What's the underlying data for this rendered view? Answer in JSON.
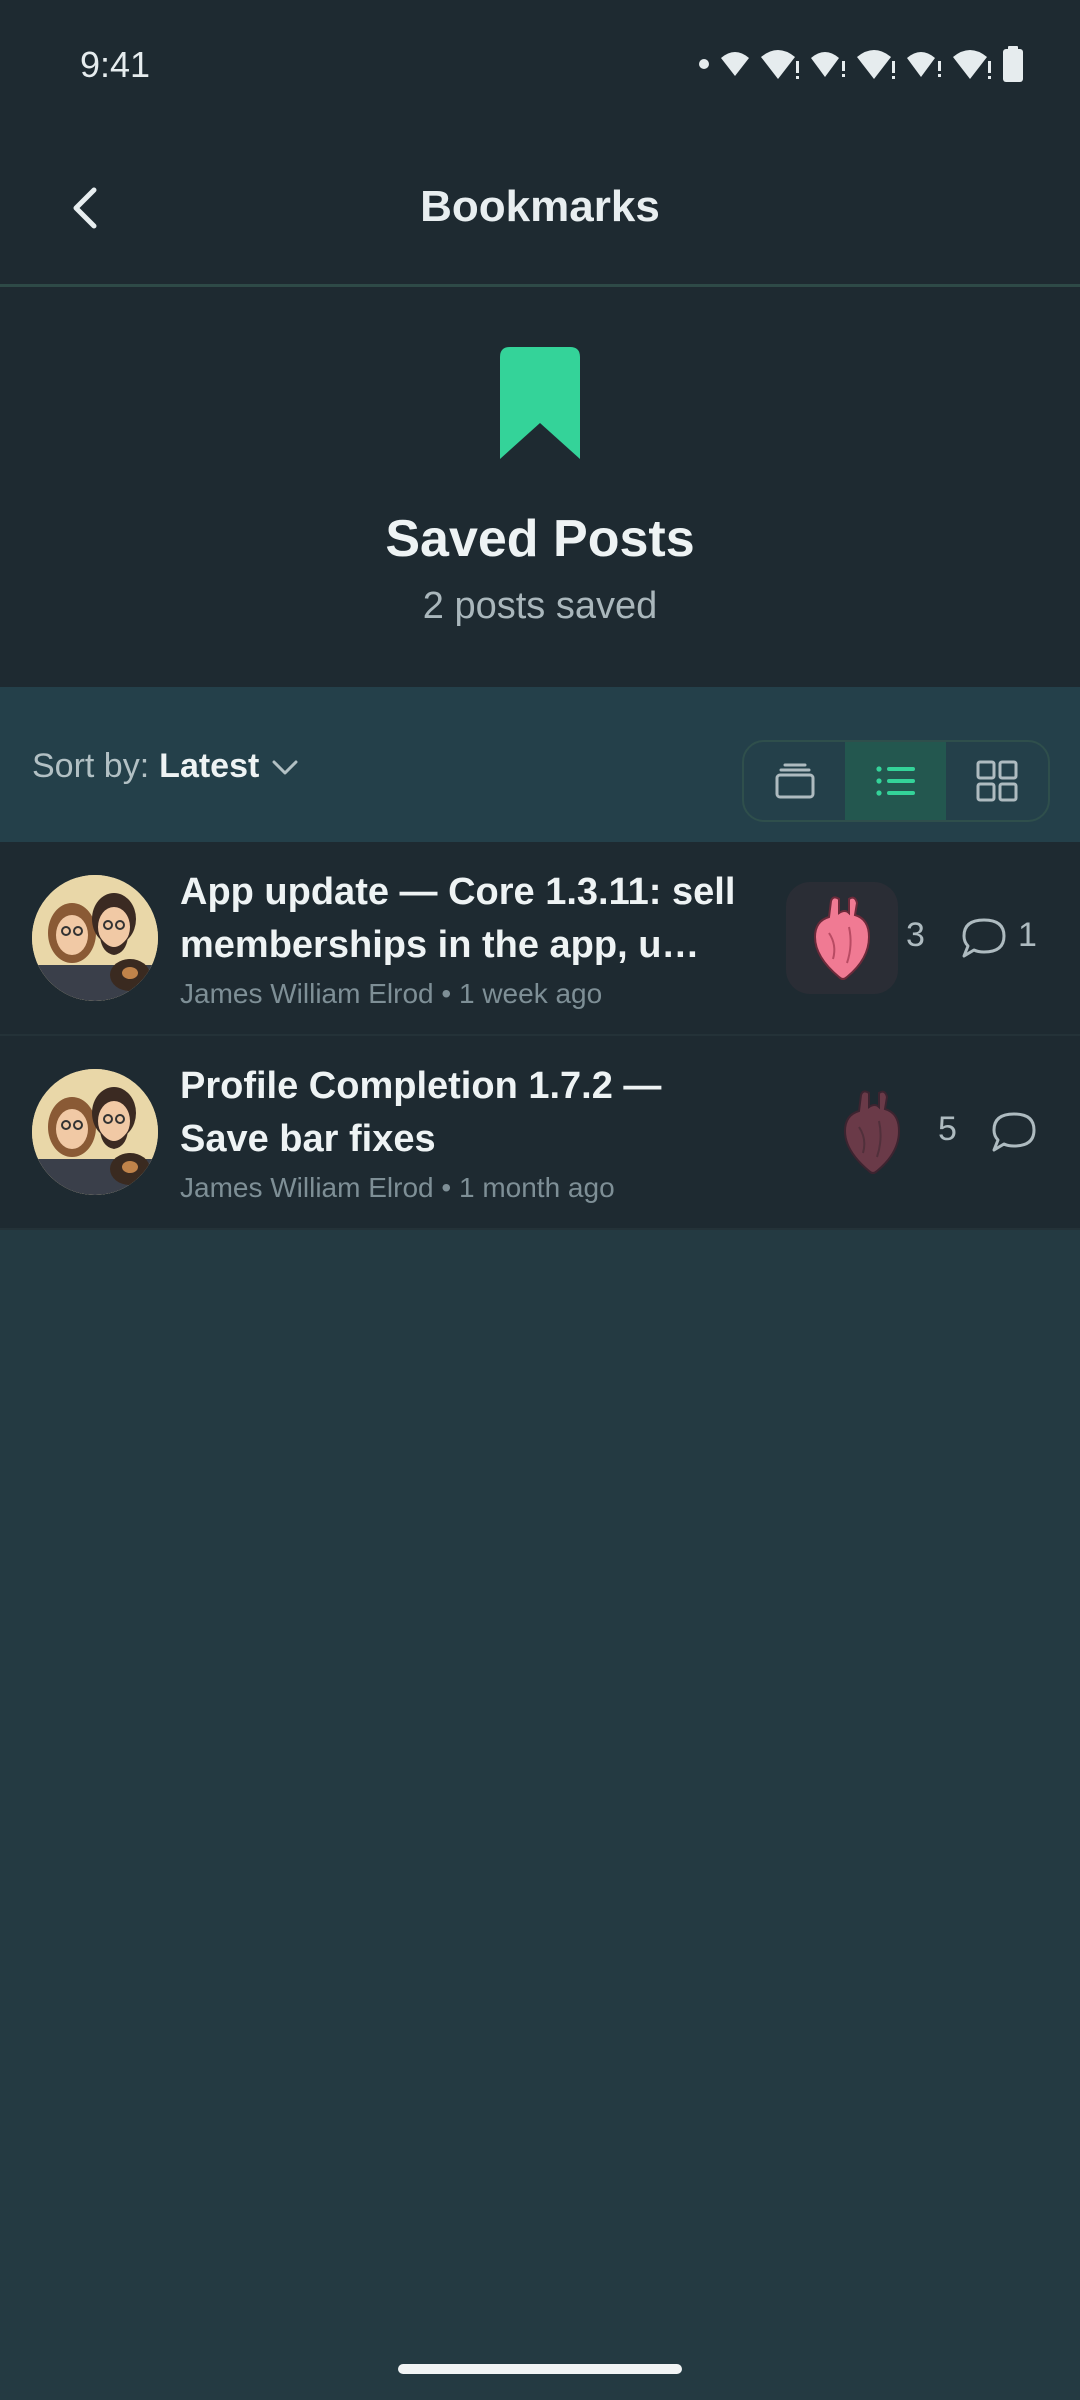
{
  "status_bar": {
    "time": "9:41"
  },
  "app_bar": {
    "title": "Bookmarks"
  },
  "hero": {
    "title": "Saved Posts",
    "subtitle": "2 posts saved"
  },
  "sort": {
    "label": "Sort by:",
    "value": "Latest"
  },
  "view_modes": [
    "card",
    "list",
    "grid"
  ],
  "active_view_mode": "list",
  "posts": [
    {
      "title": "App update — Core 1.3.11: sell memberships in the app, u…",
      "author": "James William Elrod",
      "time": "1 week ago",
      "reaction_count": "3",
      "comment_count": "1",
      "reaction_icon": "anatomical-heart-icon",
      "reacted": true
    },
    {
      "title": "Profile Completion 1.7.2 — Save bar fixes",
      "author": "James William Elrod",
      "time": "1 month ago",
      "reaction_count": "5",
      "comment_count": "",
      "reaction_icon": "anatomical-heart-icon",
      "reacted": false
    }
  ],
  "colors": {
    "accent": "#34d399",
    "background": "#243a42",
    "surface": "#1e2a31"
  }
}
